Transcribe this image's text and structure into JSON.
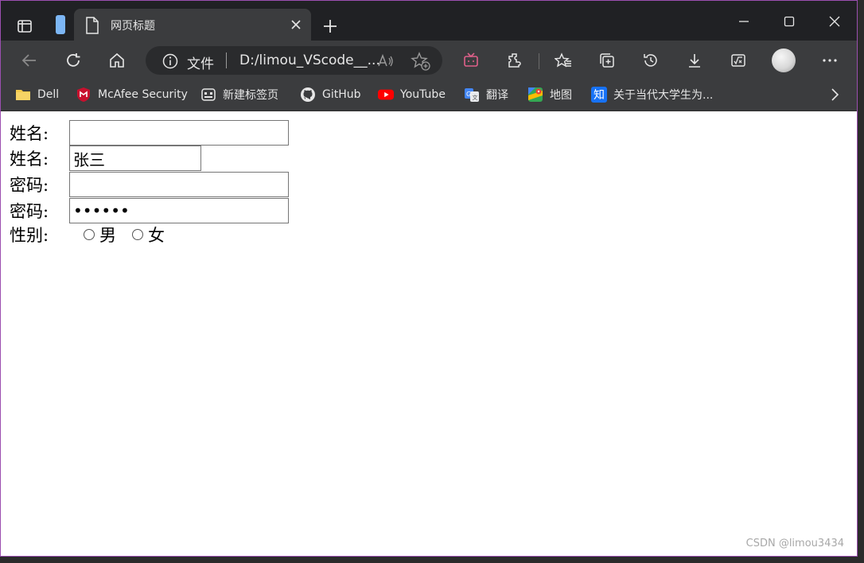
{
  "browser": {
    "tab": {
      "title": "网页标题"
    },
    "address": {
      "label": "文件",
      "url": "D:/limou_VScode__..."
    },
    "bookmarks": [
      {
        "label": "Dell",
        "icon": "folder-icon"
      },
      {
        "label": "McAfee Security",
        "icon": "mcafee-icon"
      },
      {
        "label": "新建标签页",
        "icon": "new-tab-page-icon"
      },
      {
        "label": "GitHub",
        "icon": "github-icon"
      },
      {
        "label": "YouTube",
        "icon": "youtube-icon"
      },
      {
        "label": "翻译",
        "icon": "translate-icon"
      },
      {
        "label": "地图",
        "icon": "maps-icon"
      },
      {
        "label": "关于当代大学生为...",
        "icon": "zhihu-icon",
        "glyph": "知"
      }
    ]
  },
  "form": {
    "name1": {
      "label": "姓名:",
      "value": ""
    },
    "name2": {
      "label": "姓名:",
      "value": "张三"
    },
    "password1": {
      "label": "密码:",
      "value": ""
    },
    "password2": {
      "label": "密码:",
      "value": "123456"
    },
    "gender": {
      "label": "性别:",
      "options": [
        "男",
        "女"
      ]
    }
  },
  "watermark": "CSDN @limou3434",
  "colors": {
    "titlebar": "#202124",
    "toolbar": "#3b3c3e",
    "addressbar": "#2a2b2d",
    "border": "#9b4fb0"
  }
}
